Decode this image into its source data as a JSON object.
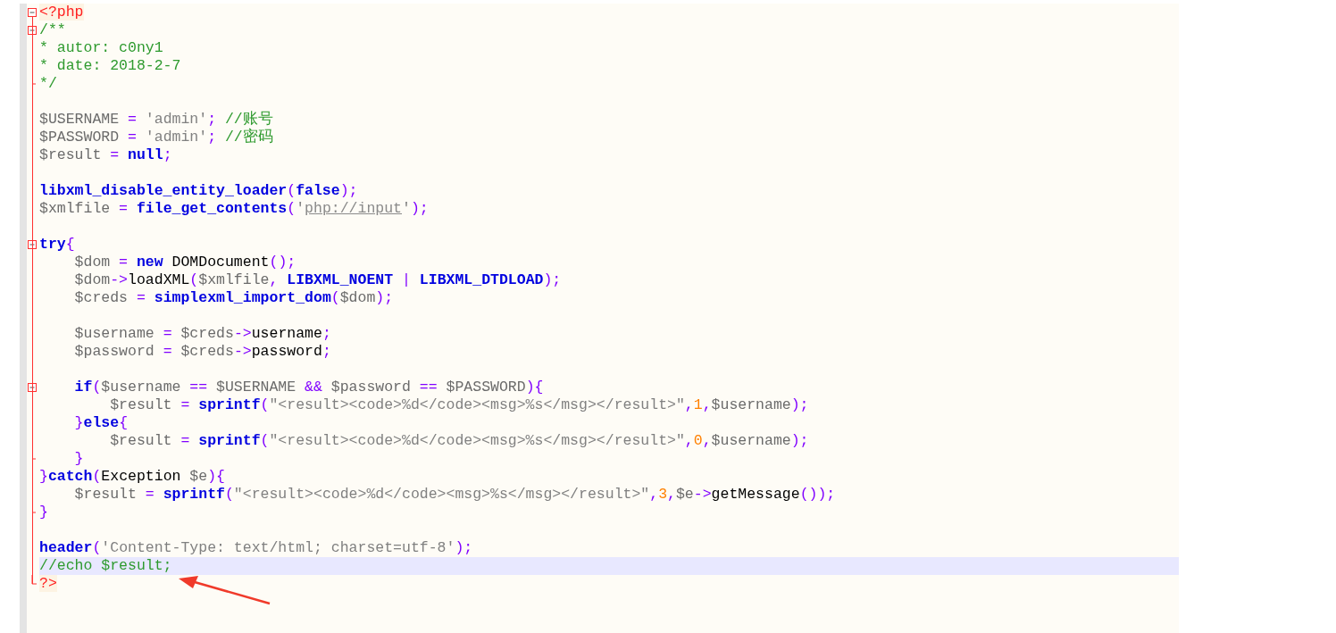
{
  "editor": {
    "lines": [
      {
        "kind": "fold-start",
        "selected": false,
        "tokens": [
          {
            "kind": "php",
            "text": "<?php"
          }
        ]
      },
      {
        "kind": "fold-open",
        "selected": false,
        "tokens": [
          {
            "kind": "comment",
            "text": "/**"
          }
        ]
      },
      {
        "kind": "plain",
        "selected": false,
        "tokens": [
          {
            "kind": "comment",
            "text": "* autor: c0ny1"
          }
        ]
      },
      {
        "kind": "plain",
        "selected": false,
        "tokens": [
          {
            "kind": "comment",
            "text": "* date: 2018-2-7"
          }
        ]
      },
      {
        "kind": "fold-end",
        "selected": false,
        "tokens": [
          {
            "kind": "comment",
            "text": "*/"
          }
        ]
      },
      {
        "kind": "plain",
        "selected": false
      },
      {
        "kind": "plain",
        "selected": false,
        "tokens": [
          {
            "kind": "var",
            "text": "$USERNAME"
          },
          {
            "kind": "op",
            "text": " = "
          },
          {
            "kind": "str",
            "text": "'admin'"
          },
          {
            "kind": "op",
            "text": "; "
          },
          {
            "kind": "comment",
            "text": "//账号"
          }
        ]
      },
      {
        "kind": "plain",
        "selected": false,
        "tokens": [
          {
            "kind": "var",
            "text": "$PASSWORD"
          },
          {
            "kind": "op",
            "text": " = "
          },
          {
            "kind": "str",
            "text": "'admin'"
          },
          {
            "kind": "op",
            "text": "; "
          },
          {
            "kind": "comment",
            "text": "//密码"
          }
        ]
      },
      {
        "kind": "plain",
        "selected": false,
        "tokens": [
          {
            "kind": "var",
            "text": "$result"
          },
          {
            "kind": "op",
            "text": " = "
          },
          {
            "kind": "kw",
            "text": "null"
          },
          {
            "kind": "op",
            "text": ";"
          }
        ]
      },
      {
        "kind": "plain",
        "selected": false
      },
      {
        "kind": "plain",
        "selected": false,
        "tokens": [
          {
            "kind": "kw",
            "text": "libxml_disable_entity_loader"
          },
          {
            "kind": "op",
            "text": "("
          },
          {
            "kind": "kw",
            "text": "false"
          },
          {
            "kind": "op",
            "text": ");"
          }
        ]
      },
      {
        "kind": "plain",
        "selected": false,
        "tokens": [
          {
            "kind": "var",
            "text": "$xmlfile"
          },
          {
            "kind": "op",
            "text": " = "
          },
          {
            "kind": "kw",
            "text": "file_get_contents"
          },
          {
            "kind": "op",
            "text": "("
          },
          {
            "kind": "str",
            "text": "'"
          },
          {
            "kind": "url",
            "text": "php://input"
          },
          {
            "kind": "str",
            "text": "'"
          },
          {
            "kind": "op",
            "text": ");"
          }
        ]
      },
      {
        "kind": "plain",
        "selected": false
      },
      {
        "kind": "fold-open",
        "selected": false,
        "tokens": [
          {
            "kind": "kw",
            "text": "try"
          },
          {
            "kind": "op",
            "text": "{"
          }
        ]
      },
      {
        "kind": "plain",
        "selected": false,
        "tokens": [
          {
            "kind": "var",
            "text": "    $dom"
          },
          {
            "kind": "op",
            "text": " = "
          },
          {
            "kind": "kw",
            "text": "new"
          },
          {
            "kind": "plain",
            "text": " DOMDocument"
          },
          {
            "kind": "op",
            "text": "();"
          }
        ]
      },
      {
        "kind": "plain",
        "selected": false,
        "tokens": [
          {
            "kind": "var",
            "text": "    $dom"
          },
          {
            "kind": "op",
            "text": "->"
          },
          {
            "kind": "plain",
            "text": "loadXML"
          },
          {
            "kind": "op",
            "text": "("
          },
          {
            "kind": "var",
            "text": "$xmlfile"
          },
          {
            "kind": "op",
            "text": ", "
          },
          {
            "kind": "kw",
            "text": "LIBXML_NOENT"
          },
          {
            "kind": "op",
            "text": " | "
          },
          {
            "kind": "kw",
            "text": "LIBXML_DTDLOAD"
          },
          {
            "kind": "op",
            "text": ");"
          }
        ]
      },
      {
        "kind": "plain",
        "selected": false,
        "tokens": [
          {
            "kind": "var",
            "text": "    $creds"
          },
          {
            "kind": "op",
            "text": " = "
          },
          {
            "kind": "kw",
            "text": "simplexml_import_dom"
          },
          {
            "kind": "op",
            "text": "("
          },
          {
            "kind": "var",
            "text": "$dom"
          },
          {
            "kind": "op",
            "text": ");"
          }
        ]
      },
      {
        "kind": "plain",
        "selected": false
      },
      {
        "kind": "plain",
        "selected": false,
        "tokens": [
          {
            "kind": "var",
            "text": "    $username"
          },
          {
            "kind": "op",
            "text": " = "
          },
          {
            "kind": "var",
            "text": "$creds"
          },
          {
            "kind": "op",
            "text": "->"
          },
          {
            "kind": "plain",
            "text": "username"
          },
          {
            "kind": "op",
            "text": ";"
          }
        ]
      },
      {
        "kind": "plain",
        "selected": false,
        "tokens": [
          {
            "kind": "var",
            "text": "    $password"
          },
          {
            "kind": "op",
            "text": " = "
          },
          {
            "kind": "var",
            "text": "$creds"
          },
          {
            "kind": "op",
            "text": "->"
          },
          {
            "kind": "plain",
            "text": "password"
          },
          {
            "kind": "op",
            "text": ";"
          }
        ]
      },
      {
        "kind": "plain",
        "selected": false
      },
      {
        "kind": "fold-open",
        "selected": false,
        "tokens": [
          {
            "kind": "kw",
            "text": "    if"
          },
          {
            "kind": "op",
            "text": "("
          },
          {
            "kind": "var",
            "text": "$username"
          },
          {
            "kind": "op",
            "text": " == "
          },
          {
            "kind": "var",
            "text": "$USERNAME"
          },
          {
            "kind": "op",
            "text": " && "
          },
          {
            "kind": "var",
            "text": "$password"
          },
          {
            "kind": "op",
            "text": " == "
          },
          {
            "kind": "var",
            "text": "$PASSWORD"
          },
          {
            "kind": "op",
            "text": "){"
          }
        ]
      },
      {
        "kind": "plain",
        "selected": false,
        "tokens": [
          {
            "kind": "var",
            "text": "        $result"
          },
          {
            "kind": "op",
            "text": " = "
          },
          {
            "kind": "kw",
            "text": "sprintf"
          },
          {
            "kind": "op",
            "text": "("
          },
          {
            "kind": "str",
            "text": "\"<result><code>%d</code><msg>%s</msg></result>\""
          },
          {
            "kind": "op",
            "text": ","
          },
          {
            "kind": "num",
            "text": "1"
          },
          {
            "kind": "op",
            "text": ","
          },
          {
            "kind": "var",
            "text": "$username"
          },
          {
            "kind": "op",
            "text": ");"
          }
        ]
      },
      {
        "kind": "plain",
        "selected": false,
        "tokens": [
          {
            "kind": "op",
            "text": "    }"
          },
          {
            "kind": "kw",
            "text": "else"
          },
          {
            "kind": "op",
            "text": "{"
          }
        ]
      },
      {
        "kind": "plain",
        "selected": false,
        "tokens": [
          {
            "kind": "var",
            "text": "        $result"
          },
          {
            "kind": "op",
            "text": " = "
          },
          {
            "kind": "kw",
            "text": "sprintf"
          },
          {
            "kind": "op",
            "text": "("
          },
          {
            "kind": "str",
            "text": "\"<result><code>%d</code><msg>%s</msg></result>\""
          },
          {
            "kind": "op",
            "text": ","
          },
          {
            "kind": "num",
            "text": "0"
          },
          {
            "kind": "op",
            "text": ","
          },
          {
            "kind": "var",
            "text": "$username"
          },
          {
            "kind": "op",
            "text": ");"
          }
        ]
      },
      {
        "kind": "fold-end",
        "selected": false,
        "tokens": [
          {
            "kind": "op",
            "text": "    }"
          }
        ]
      },
      {
        "kind": "plain",
        "selected": false,
        "tokens": [
          {
            "kind": "op",
            "text": "}"
          },
          {
            "kind": "kw",
            "text": "catch"
          },
          {
            "kind": "op",
            "text": "("
          },
          {
            "kind": "plain",
            "text": "Exception "
          },
          {
            "kind": "var",
            "text": "$e"
          },
          {
            "kind": "op",
            "text": "){"
          }
        ]
      },
      {
        "kind": "plain",
        "selected": false,
        "tokens": [
          {
            "kind": "var",
            "text": "    $result"
          },
          {
            "kind": "op",
            "text": " = "
          },
          {
            "kind": "kw",
            "text": "sprintf"
          },
          {
            "kind": "op",
            "text": "("
          },
          {
            "kind": "str",
            "text": "\"<result><code>%d</code><msg>%s</msg></result>\""
          },
          {
            "kind": "op",
            "text": ","
          },
          {
            "kind": "num",
            "text": "3"
          },
          {
            "kind": "op",
            "text": ","
          },
          {
            "kind": "var",
            "text": "$e"
          },
          {
            "kind": "op",
            "text": "->"
          },
          {
            "kind": "plain",
            "text": "getMessage"
          },
          {
            "kind": "op",
            "text": "());"
          }
        ]
      },
      {
        "kind": "fold-end",
        "selected": false,
        "tokens": [
          {
            "kind": "op",
            "text": "}"
          }
        ]
      },
      {
        "kind": "plain",
        "selected": false
      },
      {
        "kind": "plain",
        "selected": false,
        "tokens": [
          {
            "kind": "kw",
            "text": "header"
          },
          {
            "kind": "op",
            "text": "("
          },
          {
            "kind": "str",
            "text": "'Content-Type: text/html; charset=utf-8'"
          },
          {
            "kind": "op",
            "text": ");"
          }
        ]
      },
      {
        "kind": "plain",
        "selected": true,
        "tokens": [
          {
            "kind": "comment",
            "text": "//echo $result;"
          }
        ]
      },
      {
        "kind": "fold-last",
        "selected": false,
        "tokens": [
          {
            "kind": "php",
            "text": "?>"
          }
        ]
      }
    ]
  }
}
